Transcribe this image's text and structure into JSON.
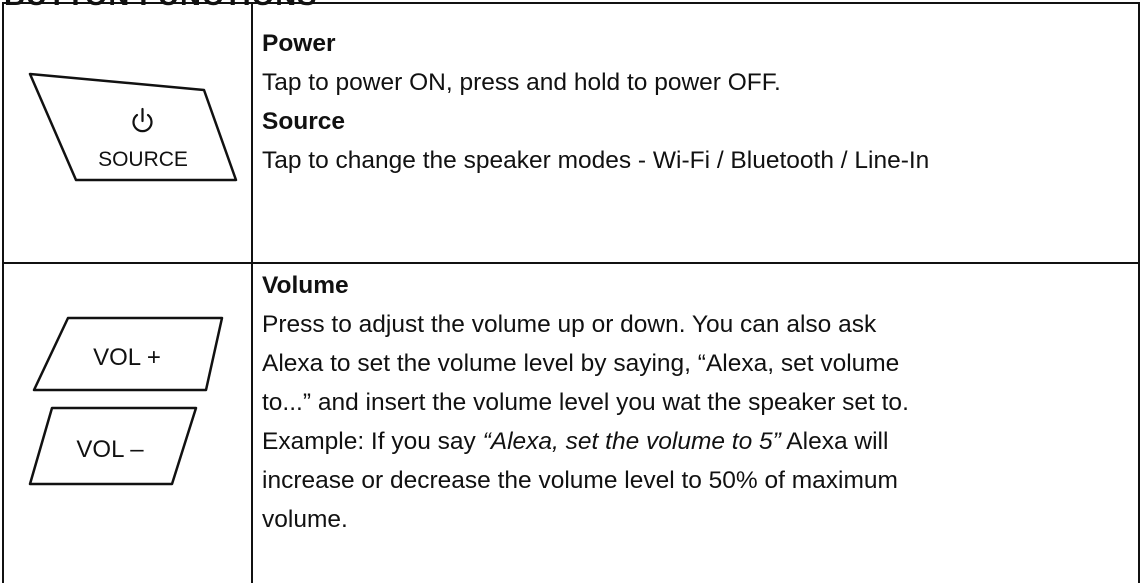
{
  "heading": "BUTTON FUNCTIONS",
  "rows": [
    {
      "icons": [
        "power-source-button"
      ],
      "icon_labels": {
        "source": "SOURCE",
        "power_symbol": "power-icon"
      },
      "entries": [
        {
          "title": "Power",
          "text": "Tap to power ON, press and hold to power OFF."
        },
        {
          "title": "Source",
          "text": "Tap to change the speaker modes - Wi-Fi / Bluetooth / Line-In"
        }
      ]
    },
    {
      "icons": [
        "volume-up-button",
        "volume-down-button"
      ],
      "icon_labels": {
        "vol_up": "VOL +",
        "vol_down": "VOL –"
      },
      "entries": [
        {
          "title": "Volume",
          "lines": [
            "Press to adjust the volume up or down. You can also ask",
            "Alexa to set the volume level by saying, “Alexa, set volume",
            "to...” and insert the volume level you wat the speaker set to."
          ],
          "example_prefix": "Example: If you say ",
          "example_quote": "“Alexa, set the volume to 5”",
          "example_suffix": " Alexa will",
          "tail_lines": [
            "increase or decrease the volume level to 50% of maximum",
            "volume."
          ]
        }
      ]
    }
  ]
}
